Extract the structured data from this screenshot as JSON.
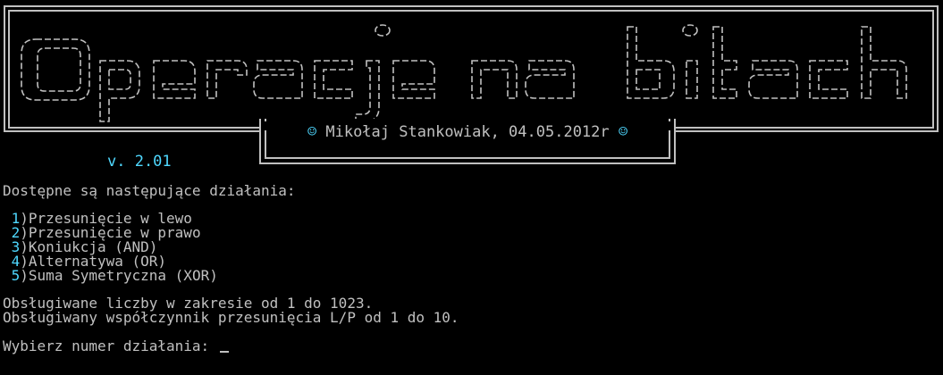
{
  "banner": {
    "title": "Operacje na bitach",
    "credit_name": "Mikołaj Stankowiak, 04.05.2012r",
    "smile_glyph": "☺"
  },
  "version": "v. 2.01",
  "intro": "Dostępne są następujące działania:",
  "menu": [
    {
      "num": "1",
      "label": ")Przesunięcie w lewo"
    },
    {
      "num": "2",
      "label": ")Przesunięcie w prawo"
    },
    {
      "num": "3",
      "label": ")Koniukcja (AND)"
    },
    {
      "num": "4",
      "label": ")Alternatywa (OR)"
    },
    {
      "num": "5",
      "label": ")Suma Symetryczna (XOR)"
    }
  ],
  "info": [
    "Obsługiwane liczby w zakresie od 1 do 1023.",
    "Obsługiwany współczynnik przesunięcia L/P od 1 do 10."
  ],
  "prompt": "Wybierz numer działania: ",
  "colors": {
    "background": "#000000",
    "text": "#c0c0c0",
    "accent": "#4fd8ff"
  }
}
